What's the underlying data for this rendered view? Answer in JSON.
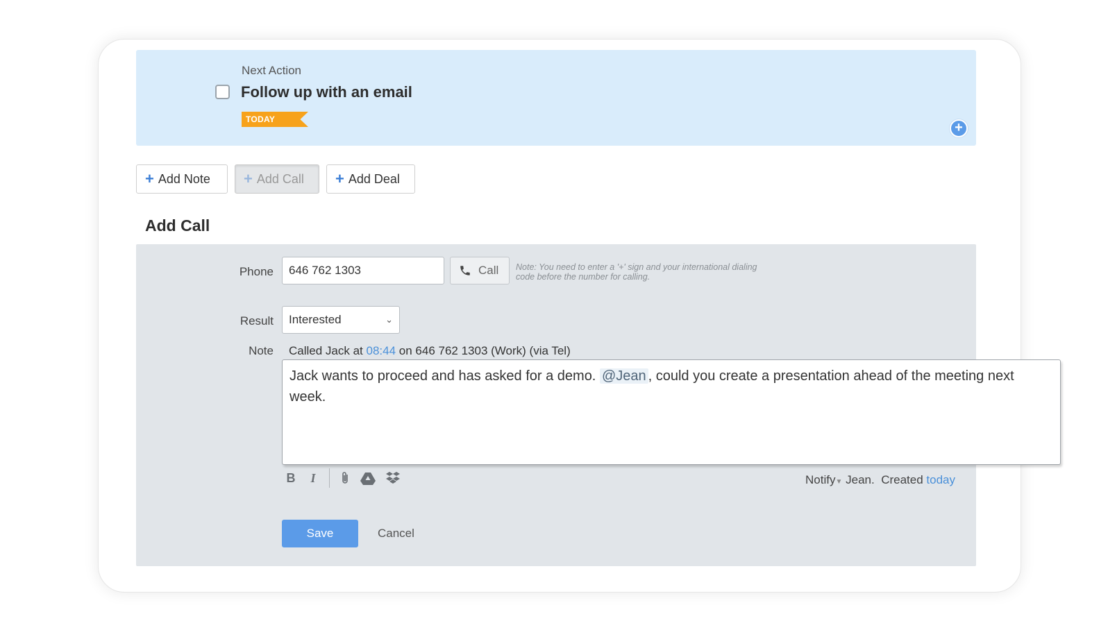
{
  "next_action": {
    "label": "Next Action",
    "title": "Follow up with an email",
    "badge": "TODAY"
  },
  "tabs": [
    {
      "label": "Add Note",
      "active": false
    },
    {
      "label": "Add Call",
      "active": true
    },
    {
      "label": "Add Deal",
      "active": false
    }
  ],
  "section_title": "Add Call",
  "form": {
    "phone_label": "Phone",
    "phone_value": "646 762 1303",
    "call_button": "Call",
    "hint": "Note: You need to enter a '+' sign and your international dialing code before the number for calling.",
    "result_label": "Result",
    "result_value": "Interested",
    "note_label": "Note",
    "summary": {
      "prefix": "Called Jack at",
      "time": "08:44",
      "suffix": "on 646 762 1303 (Work) (via Tel)"
    },
    "note_text_1": "Jack wants to proceed and has asked for a demo.",
    "mention": "@Jean",
    "note_text_2": ", could you create a presentation ahead of the meeting next week.",
    "notify_label": "Notify",
    "notify_who": "Jean.",
    "created_label": "Created",
    "created_value": "today",
    "save": "Save",
    "cancel": "Cancel"
  },
  "icons": {
    "checkbox": "checkbox-icon",
    "plus": "plus-icon",
    "phone": "phone-icon",
    "bold": "bold-icon",
    "italic": "italic-icon",
    "attach": "paperclip-icon",
    "drive": "google-drive-icon",
    "dropbox": "dropbox-icon"
  },
  "colors": {
    "accent": "#5b9be8",
    "badge": "#f7a21b",
    "next_action_bg": "#d9ecfb",
    "panel_bg": "#e1e5e9"
  }
}
